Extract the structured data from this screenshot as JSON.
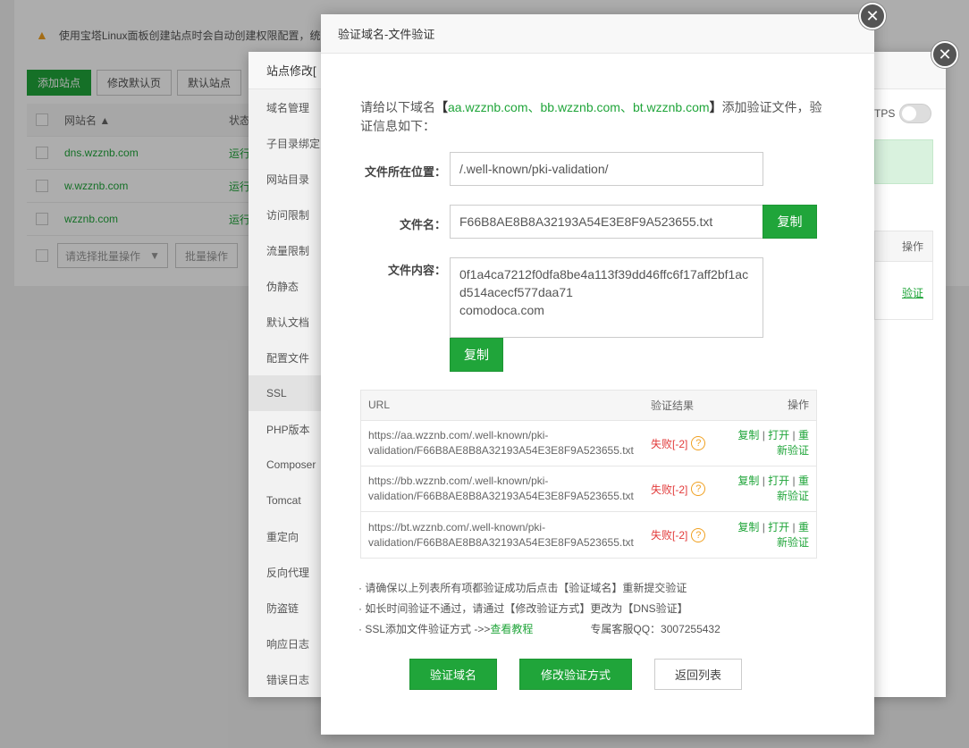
{
  "background": {
    "notice": "使用宝塔Linux面板创建站点时会自动创建权限配置，统",
    "toolbar": [
      "添加站点",
      "修改默认页",
      "默认站点"
    ],
    "table_headers": {
      "site": "网站名 ▲",
      "status": "状态"
    },
    "rows": [
      {
        "site": "dns.wzznb.com",
        "status": "运行"
      },
      {
        "site": "w.wzznb.com",
        "status": "运行"
      },
      {
        "site": "wzznb.com",
        "status": "运行"
      }
    ],
    "batch_placeholder": "请选择批量操作",
    "batch_button": "批量操作"
  },
  "site_modal": {
    "title": "站点修改[",
    "menu": [
      "域名管理",
      "子目录绑定",
      "网站目录",
      "访问限制",
      "流量限制",
      "伪静态",
      "默认文档",
      "配置文件",
      "SSL",
      "PHP版本",
      "Composer",
      "Tomcat",
      "重定向",
      "反向代理",
      "防盗链",
      "响应日志",
      "错误日志"
    ],
    "active_menu": "SSL",
    "https_label": "TPS",
    "ops_header": "操作",
    "ops_link": "验证"
  },
  "verify_modal": {
    "title": "验证域名-文件验证",
    "intro_prefix": "请给以下域名",
    "bracket_open": "【",
    "domains": "aa.wzznb.com、bb.wzznb.com、bt.wzznb.com",
    "bracket_close": "】",
    "intro_suffix": "添加验证文件，验证信息如下：",
    "location_label": "文件所在位置：",
    "location_value": "/.well-known/pki-validation/",
    "filename_label": "文件名：",
    "filename_value": "F66B8AE8B8A32193A54E3E8F9A523655.txt",
    "content_label": "文件内容：",
    "content_value": "0f1a4ca7212f0dfa8be4a113f39dd46ffc6f17aff2bf1acd514acecf577daa71\ncomodoca.com",
    "copy_label": "复制",
    "table": {
      "headers": {
        "url": "URL",
        "result": "验证结果",
        "op": "操作"
      },
      "rows": [
        {
          "url1": "https://aa.wzznb.com/.well-known/pki-",
          "url2": "validation/F66B8AE8B8A32193A54E3E8F9A523655.txt",
          "result": "失败[-2]"
        },
        {
          "url1": "https://bb.wzznb.com/.well-known/pki-",
          "url2": "validation/F66B8AE8B8A32193A54E3E8F9A523655.txt",
          "result": "失败[-2]"
        },
        {
          "url1": "https://bt.wzznb.com/.well-known/pki-",
          "url2": "validation/F66B8AE8B8A32193A54E3E8F9A523655.txt",
          "result": "失败[-2]"
        }
      ],
      "op_copy": "复制",
      "op_open": "打开",
      "op_re1": "重",
      "op_re2": "新验证",
      "sep": " | "
    },
    "notes": {
      "n1": "· 请确保以上列表所有项都验证成功后点击【验证域名】重新提交验证",
      "n2": "· 如长时间验证不通过，请通过【修改验证方式】更改为【DNS验证】",
      "n3_prefix": "· SSL添加文件验证方式 ->> ",
      "n3_link": "查看教程",
      "qq": "专属客服QQ：3007255432"
    },
    "buttons": {
      "verify": "验证域名",
      "change": "修改验证方式",
      "back": "返回列表"
    }
  }
}
